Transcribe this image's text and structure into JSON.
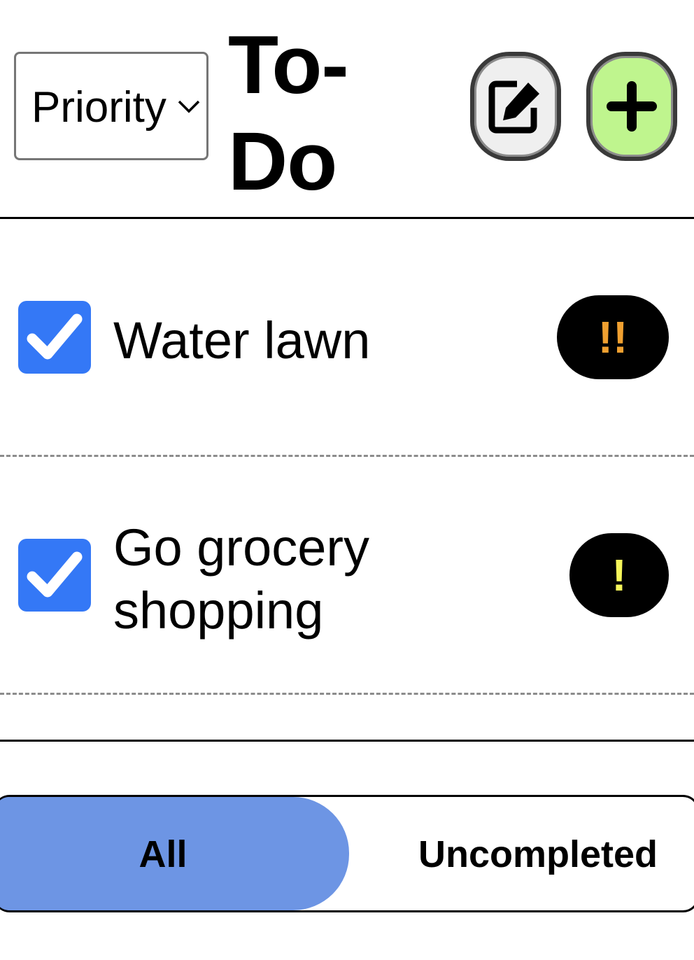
{
  "header": {
    "sort_select": {
      "value": "Priority",
      "icon": "chevron-down-icon"
    },
    "title": "To-\nDo",
    "edit_button": {
      "icon": "edit-icon",
      "background": "#efefef"
    },
    "add_button": {
      "icon": "plus-icon",
      "background": "#bff58e"
    }
  },
  "todos": [
    {
      "text": "Water lawn",
      "checked": true,
      "priority": "!!",
      "priority_color": "#f0a030"
    },
    {
      "text": "Go grocery shopping",
      "checked": true,
      "priority": "!",
      "priority_color": "#f5f55a"
    }
  ],
  "filter": {
    "options": [
      {
        "label": "All",
        "selected": true
      },
      {
        "label": "Uncompleted",
        "selected": false
      }
    ],
    "accent": "#6d95e4"
  },
  "colors": {
    "checkbox": "#3478f6"
  }
}
